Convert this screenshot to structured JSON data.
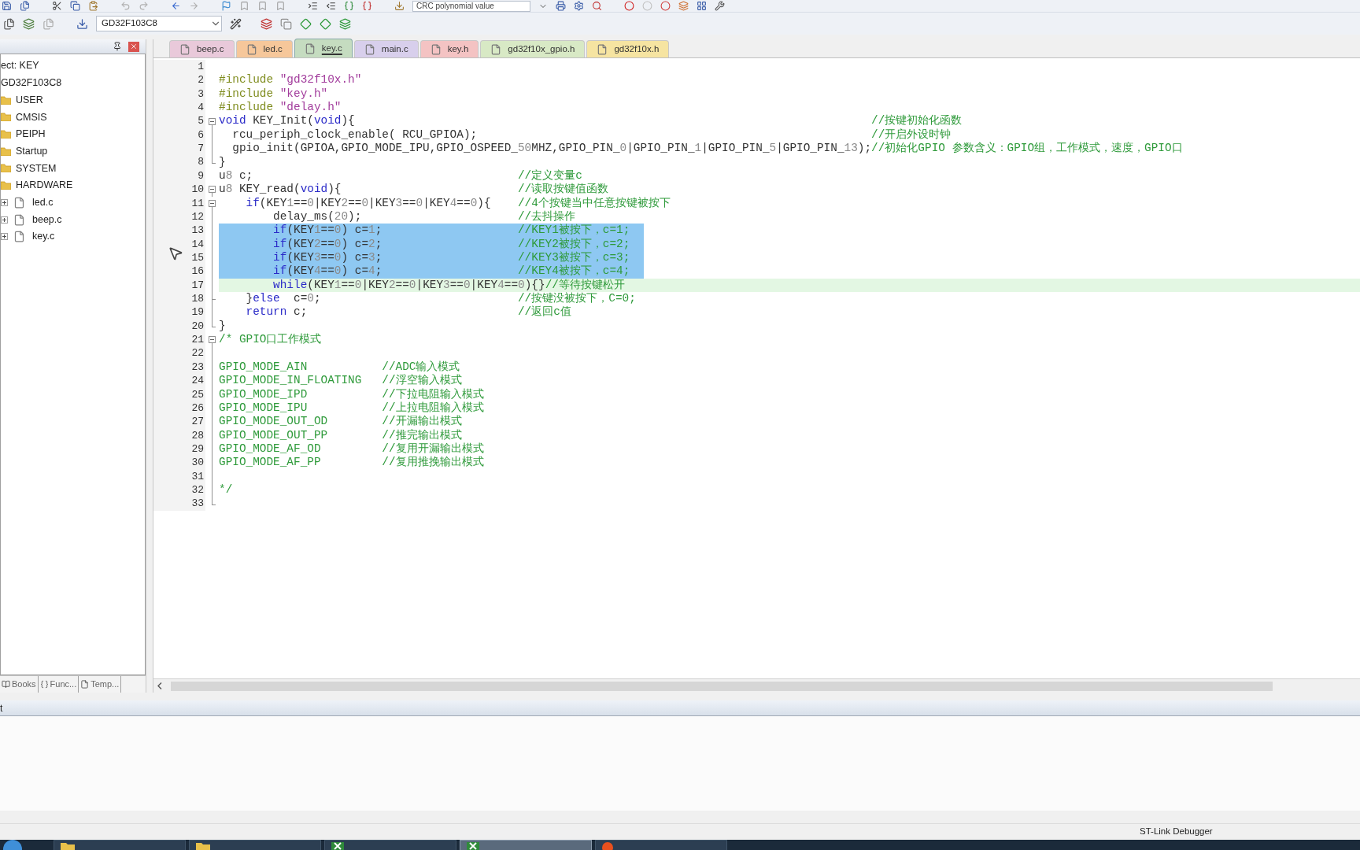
{
  "toolbar": {
    "crc_field": {
      "placeholder": "CRC polynomial value"
    },
    "target": "GD32F103C8"
  },
  "project_tree": [
    {
      "kind": "project",
      "label": "ect: KEY",
      "children": [
        {
          "kind": "target",
          "label": "GD32F103C8",
          "children": [
            {
              "kind": "folder",
              "label": "USER"
            },
            {
              "kind": "folder",
              "label": "CMSIS"
            },
            {
              "kind": "folder",
              "label": "PEIPH"
            },
            {
              "kind": "folder",
              "label": "Startup"
            },
            {
              "kind": "folder",
              "label": "SYSTEM"
            },
            {
              "kind": "folder",
              "label": "HARDWARE",
              "children": [
                {
                  "kind": "file",
                  "label": "led.c",
                  "expanded": false
                },
                {
                  "kind": "file",
                  "label": "beep.c",
                  "expanded": false
                },
                {
                  "kind": "file",
                  "label": "key.c",
                  "expanded": false
                }
              ]
            }
          ]
        }
      ]
    }
  ],
  "panel_tabs": [
    {
      "label": "Books",
      "kind": "books"
    },
    {
      "label": "Func...",
      "kind": "functions"
    },
    {
      "label": "Temp...",
      "kind": "templates"
    }
  ],
  "tabs": [
    {
      "label": "beep.c",
      "color": "#e9c9da",
      "selected": false
    },
    {
      "label": "led.c",
      "color": "#f6c79a",
      "selected": false
    },
    {
      "label": "key.c",
      "color": "#c5dcc0",
      "selected": true
    },
    {
      "label": "main.c",
      "color": "#d8cfec",
      "selected": false
    },
    {
      "label": "key.h",
      "color": "#f4c3c3",
      "selected": false
    },
    {
      "label": "gd32f10x_gpio.h",
      "color": "#d8e9c5",
      "selected": false
    },
    {
      "label": "gd32f10x.h",
      "color": "#f6e4a1",
      "selected": false
    }
  ],
  "lines": [
    {
      "number": "1",
      "kind": "code",
      "selected": false,
      "current": false
    },
    {
      "number": "2",
      "kind": "code",
      "code": "#include \"gd32f10x.h\"",
      "selected": false,
      "current": false
    },
    {
      "number": "3",
      "kind": "code",
      "code": "#include \"key.h\"",
      "selected": false,
      "current": false
    },
    {
      "number": "4",
      "kind": "code",
      "code": "#include \"delay.h\"",
      "selected": false,
      "current": false
    },
    {
      "number": "5",
      "kind": "code",
      "code": "void KEY_Init(void){",
      "comment": "//按键初始化函数",
      "expanded": true,
      "selected": false,
      "current": false
    },
    {
      "number": "6",
      "kind": "code",
      "code": "  rcu_periph_clock_enable( RCU_GPIOA);",
      "comment": "//开启外设时钟",
      "selected": false,
      "current": false
    },
    {
      "number": "7",
      "kind": "code",
      "code": "  gpio_init(GPIOA,GPIO_MODE_IPU,GPIO_OSPEED_50MHZ,GPIO_PIN_0|GPIO_PIN_1|GPIO_PIN_5|GPIO_PIN_13);",
      "comment": "//初始化GPIO 参数含义：GPIO组，工作模式，速度，GPIO口",
      "selected": false,
      "current": false
    },
    {
      "number": "8",
      "kind": "code",
      "code": "}",
      "fold_end": true,
      "selected": false,
      "current": false
    },
    {
      "number": "9",
      "kind": "code",
      "code": "u8 c;",
      "comment": "//定义变量c",
      "selected": false,
      "current": false
    },
    {
      "number": "10",
      "kind": "code",
      "code": "u8 KEY_read(void){",
      "comment": "//读取按键值函数",
      "expanded": true,
      "selected": false,
      "current": false
    },
    {
      "number": "11",
      "kind": "code",
      "code": "    if(KEY1==0|KEY2==0|KEY3==0|KEY4==0){",
      "comment": "//4个按键当中任意按键被按下",
      "expanded": true,
      "selected": false,
      "current": false
    },
    {
      "number": "12",
      "kind": "code",
      "code": "        delay_ms(20);",
      "comment": "//去抖操作",
      "selected": false,
      "current": false
    },
    {
      "number": "13",
      "kind": "code",
      "code": "        if(KEY1==0) c=1;",
      "comment": "//KEY1被按下，c=1;",
      "selected": true,
      "current": false
    },
    {
      "number": "14",
      "kind": "code",
      "code": "        if(KEY2==0) c=2;",
      "comment": "//KEY2被按下，c=2;",
      "selected": true,
      "current": false
    },
    {
      "number": "15",
      "kind": "code",
      "code": "        if(KEY3==0) c=3;",
      "comment": "//KEY3被按下，c=3;",
      "selected": true,
      "current": false
    },
    {
      "number": "16",
      "kind": "code",
      "code": "        if(KEY4==0) c=4;",
      "comment": "//KEY4被按下，c=4;",
      "selected": true,
      "current": false
    },
    {
      "number": "17",
      "kind": "code",
      "code": "        while(KEY1==0|KEY2==0|KEY3==0|KEY4==0){}",
      "comment": "//等待按键松开",
      "selected": false,
      "current": true
    },
    {
      "number": "18",
      "kind": "code",
      "code": "    }else  c=0;",
      "comment": "//按键没被按下，C=0;",
      "fold_end": true,
      "selected": false,
      "current": false
    },
    {
      "number": "19",
      "kind": "code",
      "code": "    return c;",
      "comment": "//返回c值",
      "selected": false,
      "current": false
    },
    {
      "number": "20",
      "kind": "code",
      "code": "}",
      "fold_end": true,
      "selected": false,
      "current": false
    },
    {
      "number": "21",
      "kind": "block_comment",
      "code": "/* GPIO口工作模式",
      "expanded": true,
      "selected": false,
      "current": false
    },
    {
      "number": "22",
      "kind": "block_comment",
      "selected": false,
      "current": false
    },
    {
      "number": "23",
      "kind": "block_comment",
      "code": "GPIO_MODE_AIN",
      "comment": "//ADC输入模式",
      "selected": false,
      "current": false
    },
    {
      "number": "24",
      "kind": "block_comment",
      "code": "GPIO_MODE_IN_FLOATING",
      "comment": "//浮空输入模式",
      "selected": false,
      "current": false
    },
    {
      "number": "25",
      "kind": "block_comment",
      "code": "GPIO_MODE_IPD",
      "comment": "//下拉电阻输入模式",
      "selected": false,
      "current": false
    },
    {
      "number": "26",
      "kind": "block_comment",
      "code": "GPIO_MODE_IPU",
      "comment": "//上拉电阻输入模式",
      "selected": false,
      "current": false
    },
    {
      "number": "27",
      "kind": "block_comment",
      "code": "GPIO_MODE_OUT_OD",
      "comment": "//开漏输出模式",
      "selected": false,
      "current": false
    },
    {
      "number": "28",
      "kind": "block_comment",
      "code": "GPIO_MODE_OUT_PP",
      "comment": "//推完输出模式",
      "selected": false,
      "current": false
    },
    {
      "number": "29",
      "kind": "block_comment",
      "code": "GPIO_MODE_AF_OD",
      "comment": "//复用开漏输出模式",
      "selected": false,
      "current": false
    },
    {
      "number": "30",
      "kind": "block_comment",
      "code": "GPIO_MODE_AF_PP",
      "comment": "//复用推挽输出模式",
      "selected": false,
      "current": false
    },
    {
      "number": "31",
      "kind": "block_comment",
      "selected": false,
      "current": false
    },
    {
      "number": "32",
      "kind": "block_comment",
      "code": "*/",
      "selected": false,
      "current": false
    },
    {
      "number": "33",
      "kind": "code",
      "fold_end": true,
      "selected": false,
      "current": false
    }
  ],
  "output": {
    "title": "t"
  },
  "status_bar": {
    "debugger": "ST-Link Debugger"
  },
  "taskbar": [
    {
      "kind": "folder",
      "selected": false
    },
    {
      "kind": "folder",
      "selected": false
    },
    {
      "kind": "sheet",
      "selected": false
    },
    {
      "kind": "sheet",
      "selected": true
    },
    {
      "kind": "browser",
      "selected": false
    }
  ]
}
